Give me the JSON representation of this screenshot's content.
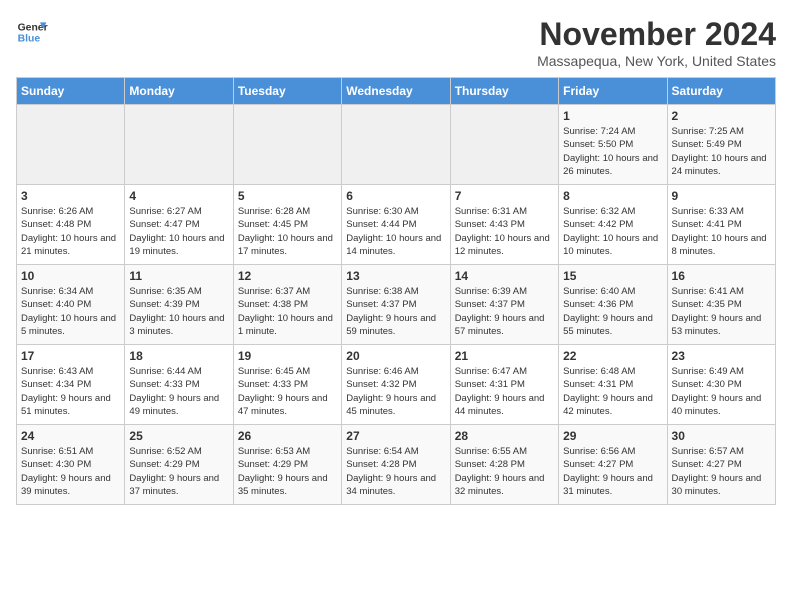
{
  "logo": {
    "line1": "General",
    "line2": "Blue"
  },
  "title": "November 2024",
  "location": "Massapequa, New York, United States",
  "days_of_week": [
    "Sunday",
    "Monday",
    "Tuesday",
    "Wednesday",
    "Thursday",
    "Friday",
    "Saturday"
  ],
  "weeks": [
    [
      {
        "day": "",
        "details": ""
      },
      {
        "day": "",
        "details": ""
      },
      {
        "day": "",
        "details": ""
      },
      {
        "day": "",
        "details": ""
      },
      {
        "day": "",
        "details": ""
      },
      {
        "day": "1",
        "details": "Sunrise: 7:24 AM\nSunset: 5:50 PM\nDaylight: 10 hours and 26 minutes."
      },
      {
        "day": "2",
        "details": "Sunrise: 7:25 AM\nSunset: 5:49 PM\nDaylight: 10 hours and 24 minutes."
      }
    ],
    [
      {
        "day": "3",
        "details": "Sunrise: 6:26 AM\nSunset: 4:48 PM\nDaylight: 10 hours and 21 minutes."
      },
      {
        "day": "4",
        "details": "Sunrise: 6:27 AM\nSunset: 4:47 PM\nDaylight: 10 hours and 19 minutes."
      },
      {
        "day": "5",
        "details": "Sunrise: 6:28 AM\nSunset: 4:45 PM\nDaylight: 10 hours and 17 minutes."
      },
      {
        "day": "6",
        "details": "Sunrise: 6:30 AM\nSunset: 4:44 PM\nDaylight: 10 hours and 14 minutes."
      },
      {
        "day": "7",
        "details": "Sunrise: 6:31 AM\nSunset: 4:43 PM\nDaylight: 10 hours and 12 minutes."
      },
      {
        "day": "8",
        "details": "Sunrise: 6:32 AM\nSunset: 4:42 PM\nDaylight: 10 hours and 10 minutes."
      },
      {
        "day": "9",
        "details": "Sunrise: 6:33 AM\nSunset: 4:41 PM\nDaylight: 10 hours and 8 minutes."
      }
    ],
    [
      {
        "day": "10",
        "details": "Sunrise: 6:34 AM\nSunset: 4:40 PM\nDaylight: 10 hours and 5 minutes."
      },
      {
        "day": "11",
        "details": "Sunrise: 6:35 AM\nSunset: 4:39 PM\nDaylight: 10 hours and 3 minutes."
      },
      {
        "day": "12",
        "details": "Sunrise: 6:37 AM\nSunset: 4:38 PM\nDaylight: 10 hours and 1 minute."
      },
      {
        "day": "13",
        "details": "Sunrise: 6:38 AM\nSunset: 4:37 PM\nDaylight: 9 hours and 59 minutes."
      },
      {
        "day": "14",
        "details": "Sunrise: 6:39 AM\nSunset: 4:37 PM\nDaylight: 9 hours and 57 minutes."
      },
      {
        "day": "15",
        "details": "Sunrise: 6:40 AM\nSunset: 4:36 PM\nDaylight: 9 hours and 55 minutes."
      },
      {
        "day": "16",
        "details": "Sunrise: 6:41 AM\nSunset: 4:35 PM\nDaylight: 9 hours and 53 minutes."
      }
    ],
    [
      {
        "day": "17",
        "details": "Sunrise: 6:43 AM\nSunset: 4:34 PM\nDaylight: 9 hours and 51 minutes."
      },
      {
        "day": "18",
        "details": "Sunrise: 6:44 AM\nSunset: 4:33 PM\nDaylight: 9 hours and 49 minutes."
      },
      {
        "day": "19",
        "details": "Sunrise: 6:45 AM\nSunset: 4:33 PM\nDaylight: 9 hours and 47 minutes."
      },
      {
        "day": "20",
        "details": "Sunrise: 6:46 AM\nSunset: 4:32 PM\nDaylight: 9 hours and 45 minutes."
      },
      {
        "day": "21",
        "details": "Sunrise: 6:47 AM\nSunset: 4:31 PM\nDaylight: 9 hours and 44 minutes."
      },
      {
        "day": "22",
        "details": "Sunrise: 6:48 AM\nSunset: 4:31 PM\nDaylight: 9 hours and 42 minutes."
      },
      {
        "day": "23",
        "details": "Sunrise: 6:49 AM\nSunset: 4:30 PM\nDaylight: 9 hours and 40 minutes."
      }
    ],
    [
      {
        "day": "24",
        "details": "Sunrise: 6:51 AM\nSunset: 4:30 PM\nDaylight: 9 hours and 39 minutes."
      },
      {
        "day": "25",
        "details": "Sunrise: 6:52 AM\nSunset: 4:29 PM\nDaylight: 9 hours and 37 minutes."
      },
      {
        "day": "26",
        "details": "Sunrise: 6:53 AM\nSunset: 4:29 PM\nDaylight: 9 hours and 35 minutes."
      },
      {
        "day": "27",
        "details": "Sunrise: 6:54 AM\nSunset: 4:28 PM\nDaylight: 9 hours and 34 minutes."
      },
      {
        "day": "28",
        "details": "Sunrise: 6:55 AM\nSunset: 4:28 PM\nDaylight: 9 hours and 32 minutes."
      },
      {
        "day": "29",
        "details": "Sunrise: 6:56 AM\nSunset: 4:27 PM\nDaylight: 9 hours and 31 minutes."
      },
      {
        "day": "30",
        "details": "Sunrise: 6:57 AM\nSunset: 4:27 PM\nDaylight: 9 hours and 30 minutes."
      }
    ]
  ]
}
